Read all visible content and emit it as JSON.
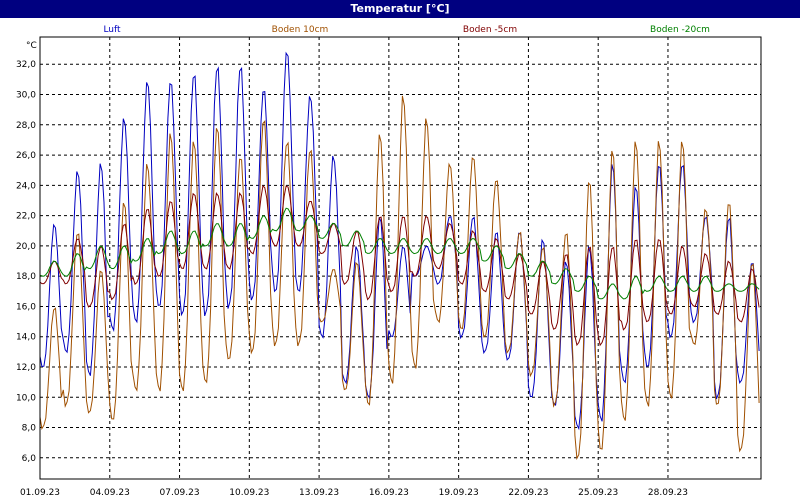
{
  "window": {
    "title": "Temperatur [°C]"
  },
  "chart_data": {
    "type": "line",
    "title": "Temperatur [°C]",
    "ylabel": "°C",
    "xlabel": "",
    "ylim": [
      4.6,
      33.8
    ],
    "xlim": [
      0,
      31
    ],
    "y_ticks": [
      6,
      8,
      10,
      12,
      14,
      16,
      18,
      20,
      22,
      24,
      26,
      28,
      30,
      32
    ],
    "y_tick_labels": [
      "6,0",
      "8,0",
      "10,0",
      "12,0",
      "14,0",
      "16,0",
      "18,0",
      "20,0",
      "22,0",
      "24,0",
      "26,0",
      "28,0",
      "30,0",
      "32,0"
    ],
    "x_ticks": [
      0,
      3,
      6,
      9,
      12,
      15,
      18,
      21,
      24,
      27
    ],
    "x_tick_labels": [
      "01.09.23",
      "04.09.23",
      "07.09.23",
      "10.09.23",
      "13.09.23",
      "16.09.23",
      "19.09.23",
      "22.09.23",
      "25.09.23",
      "28.09.23"
    ],
    "grid": true,
    "legend_position": "top",
    "series": [
      {
        "name": "Luft",
        "color": "#0000c0",
        "daily_min": [
          12.0,
          13.0,
          11.5,
          14.5,
          15.0,
          16.0,
          15.5,
          15.5,
          16.0,
          16.5,
          17.0,
          17.0,
          14.0,
          11.0,
          10.0,
          14.0,
          18.0,
          17.5,
          14.0,
          13.0,
          12.5,
          10.0,
          9.5,
          8.0,
          8.5,
          11.0,
          12.0,
          14.0,
          15.0,
          10.0,
          11.0
        ],
        "daily_max": [
          21.5,
          25.0,
          25.5,
          28.5,
          31.0,
          31.0,
          31.5,
          32.0,
          32.0,
          30.5,
          33.0,
          30.0,
          26.0,
          20.0,
          22.0,
          20.0,
          20.0,
          22.0,
          22.0,
          21.0,
          21.0,
          20.5,
          19.0,
          20.0,
          25.5,
          24.0,
          25.5,
          25.5,
          22.0,
          22.0,
          19.0
        ]
      },
      {
        "name": "Boden 10cm",
        "color": "#a05000",
        "daily_min": [
          8.0,
          9.5,
          9.0,
          8.5,
          10.5,
          10.5,
          10.5,
          11.0,
          12.5,
          13.0,
          13.5,
          13.5,
          15.0,
          10.5,
          9.5,
          11.0,
          12.0,
          15.0,
          14.5,
          14.0,
          13.0,
          11.5,
          9.5,
          6.0,
          6.5,
          8.5,
          9.5,
          10.0,
          13.5,
          9.5,
          6.5
        ],
        "daily_max": [
          16.0,
          21.0,
          18.5,
          23.0,
          25.5,
          27.5,
          27.0,
          28.0,
          26.0,
          28.5,
          27.0,
          26.5,
          18.5,
          19.0,
          27.5,
          30.0,
          28.5,
          25.5,
          26.0,
          24.5,
          21.0,
          20.0,
          21.0,
          24.5,
          26.5,
          27.0,
          27.0,
          27.0,
          22.5,
          23.0,
          19.0
        ]
      },
      {
        "name": "Boden -5cm",
        "color": "#800000",
        "daily_min": [
          17.5,
          17.5,
          16.0,
          16.5,
          17.5,
          18.0,
          18.5,
          18.5,
          18.5,
          19.5,
          20.0,
          20.0,
          19.5,
          17.5,
          16.5,
          17.0,
          18.0,
          18.5,
          17.5,
          17.0,
          16.5,
          15.5,
          14.5,
          13.5,
          13.5,
          14.5,
          15.0,
          15.5,
          16.0,
          15.5,
          15.0
        ],
        "daily_max": [
          19.0,
          20.5,
          20.0,
          21.5,
          22.5,
          23.0,
          23.5,
          23.5,
          23.5,
          24.0,
          24.0,
          23.0,
          21.5,
          21.0,
          22.0,
          22.0,
          22.0,
          21.5,
          21.0,
          20.5,
          19.5,
          19.0,
          19.5,
          20.0,
          20.0,
          20.5,
          20.5,
          20.0,
          19.5,
          19.0,
          18.5
        ]
      },
      {
        "name": "Boden -20cm",
        "color": "#008000",
        "daily_min": [
          18.0,
          18.0,
          18.5,
          18.5,
          19.0,
          19.5,
          19.5,
          20.0,
          20.0,
          20.5,
          21.0,
          21.0,
          20.5,
          20.0,
          19.5,
          19.5,
          19.5,
          19.5,
          19.5,
          19.0,
          18.5,
          18.0,
          17.5,
          17.0,
          16.5,
          16.5,
          17.0,
          17.0,
          17.0,
          17.0,
          17.0
        ],
        "daily_max": [
          19.0,
          19.5,
          20.0,
          20.0,
          20.5,
          21.0,
          21.0,
          21.5,
          21.5,
          22.0,
          22.5,
          22.0,
          21.5,
          21.0,
          20.5,
          20.5,
          20.5,
          20.5,
          20.5,
          20.0,
          19.5,
          19.0,
          18.5,
          18.0,
          17.5,
          18.0,
          18.0,
          18.0,
          18.0,
          17.5,
          17.5
        ]
      }
    ]
  }
}
